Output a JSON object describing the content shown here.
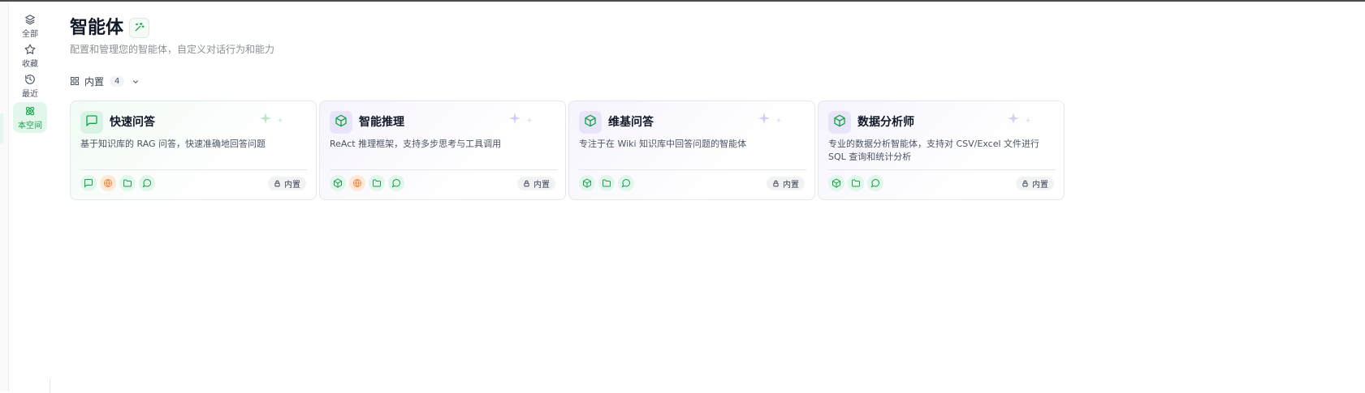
{
  "sidebar": {
    "items": [
      {
        "label": "全部",
        "icon": "layers-icon"
      },
      {
        "label": "收藏",
        "icon": "star-icon"
      },
      {
        "label": "最近",
        "icon": "history-icon"
      },
      {
        "label": "本空间",
        "icon": "atom-icon",
        "active": true
      }
    ]
  },
  "header": {
    "title": "智能体",
    "subtitle": "配置和管理您的智能体，自定义对话行为和能力"
  },
  "filter": {
    "label": "内置",
    "count": "4"
  },
  "cards": [
    {
      "title": "快速问答",
      "description": "基于知识库的 RAG 问答，快速准确地回答问题",
      "icon": "message-square-icon",
      "theme": "green",
      "badge": "内置",
      "tools": [
        "message-square-icon",
        "globe-icon",
        "folder-icon",
        "chat-bubble-icon"
      ]
    },
    {
      "title": "智能推理",
      "description": "ReAct 推理框架，支持多步思考与工具调用",
      "icon": "cube-icon",
      "theme": "purple",
      "badge": "内置",
      "tools": [
        "cube-icon",
        "globe-icon",
        "folder-icon",
        "chat-bubble-icon"
      ]
    },
    {
      "title": "维基问答",
      "description": "专注于在 Wiki 知识库中回答问题的智能体",
      "icon": "cube-icon",
      "theme": "purple",
      "badge": "内置",
      "tools": [
        "cube-icon",
        "folder-icon",
        "chat-bubble-icon"
      ]
    },
    {
      "title": "数据分析师",
      "description": "专业的数据分析智能体，支持对 CSV/Excel 文件进行 SQL 查询和统计分析",
      "icon": "cube-icon",
      "theme": "purple",
      "badge": "内置",
      "tools": [
        "cube-icon",
        "folder-icon",
        "chat-bubble-icon"
      ]
    }
  ],
  "colors": {
    "accent_green": "#16a34a",
    "accent_purple": "#7c6fd6",
    "globe_orange": "#f08a3c"
  }
}
